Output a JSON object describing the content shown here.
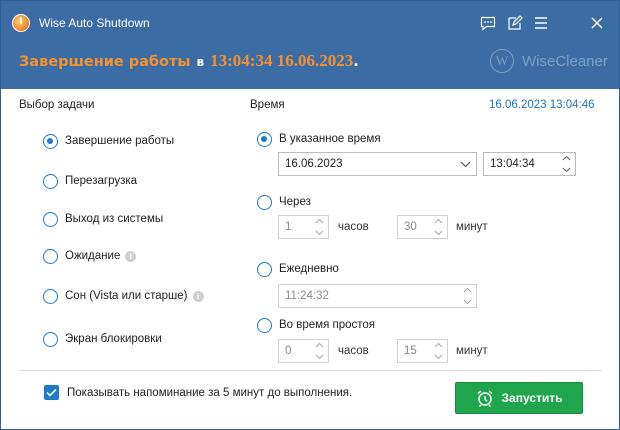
{
  "window": {
    "title": "Wise Auto Shutdown",
    "headline": {
      "action": "Завершение работы",
      "at": "в",
      "stamp": "13:04:34 16.06.2023",
      "dot": "."
    },
    "brand": {
      "mark": "W",
      "name": "WiseCleaner"
    }
  },
  "task": {
    "label": "Выбор задачи",
    "options": [
      {
        "label": "Завершение работы",
        "selected": true,
        "info": false
      },
      {
        "label": "Перезагрузка",
        "selected": false,
        "info": false
      },
      {
        "label": "Выход из системы",
        "selected": false,
        "info": false
      },
      {
        "label": "Ожидание",
        "selected": false,
        "info": true
      },
      {
        "label": "Сон (Vista или старше)",
        "selected": false,
        "info": true
      },
      {
        "label": "Экран блокировки",
        "selected": false,
        "info": false
      }
    ],
    "info_glyph": "i"
  },
  "time": {
    "label": "Время",
    "now": "16.06.2023 13:04:46",
    "specified": {
      "label": "В указанное время",
      "selected": true,
      "date": "16.06.2023",
      "time": "13:04:34"
    },
    "after": {
      "label": "Через",
      "selected": false,
      "hours": "1",
      "hours_unit": "часов",
      "minutes": "30",
      "minutes_unit": "минут"
    },
    "daily": {
      "label": "Ежедневно",
      "selected": false,
      "time": "11:24:32"
    },
    "idle": {
      "label": "Во время простоя",
      "selected": false,
      "hours": "0",
      "hours_unit": "часов",
      "minutes": "15",
      "minutes_unit": "минут"
    }
  },
  "footer": {
    "reminder": "Показывать напоминание за 5 минут до выполнения.",
    "reminder_checked": true,
    "start_label": "Запустить"
  },
  "colors": {
    "header": "#3b6ca4",
    "headline": "#f5922f",
    "accent": "#2079c7",
    "start": "#1fa64d"
  },
  "icons": {
    "app": "power-clock-icon",
    "titlebar": [
      "feedback-icon",
      "edit-icon",
      "menu-icon",
      "close-icon"
    ],
    "start": "alarm-clock-icon"
  }
}
